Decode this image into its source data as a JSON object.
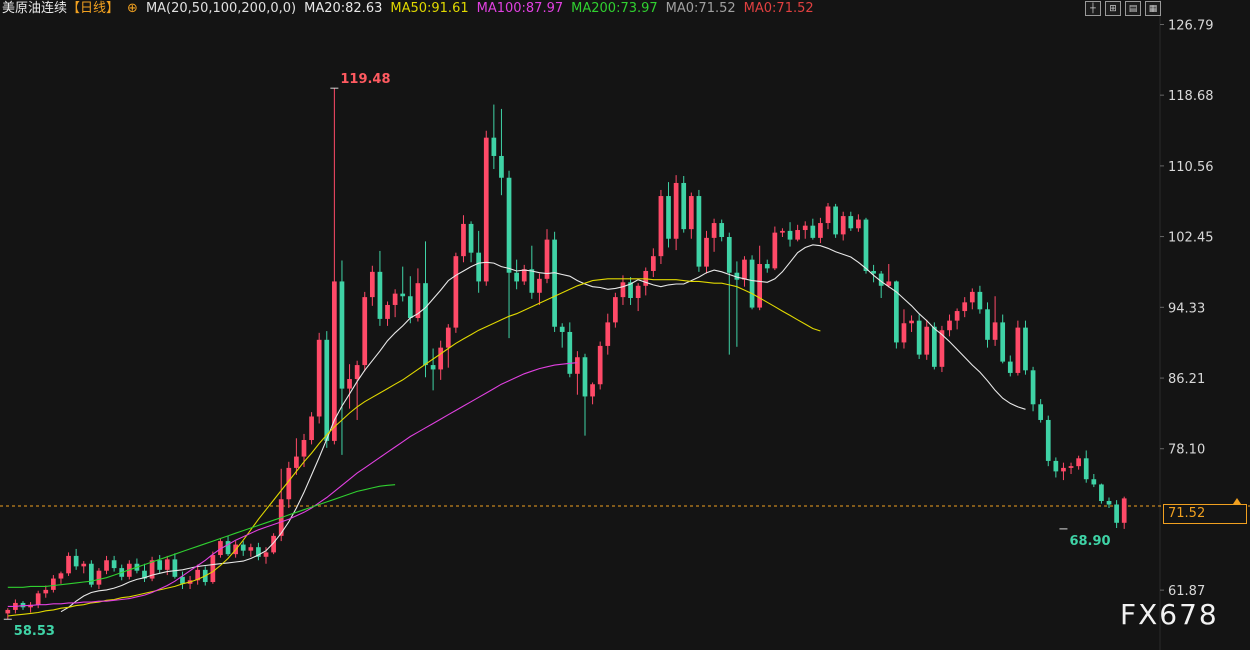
{
  "header": {
    "symbol": "美原油连续",
    "period": "【日线】",
    "ma_params": "MA(20,50,100,200,0,0)",
    "ma_values": [
      {
        "label": "MA20:82.63",
        "color": "#e8e8e8"
      },
      {
        "label": "MA50:91.61",
        "color": "#e0d800"
      },
      {
        "label": "MA100:87.97",
        "color": "#e040e0"
      },
      {
        "label": "MA200:73.97",
        "color": "#30d030"
      },
      {
        "label": "MA0:71.52",
        "color": "#a0a0a0"
      },
      {
        "label": "MA0:71.52",
        "color": "#e04040"
      }
    ]
  },
  "toolbar": {
    "icons": [
      "crosshair-icon",
      "zoom-icon",
      "indicator-icon",
      "settings-icon"
    ]
  },
  "watermark": "FX678",
  "current_price_tag": "71.52",
  "chart_data": {
    "type": "candlestick",
    "y_ticks": [
      "126.79",
      "118.68",
      "110.56",
      "102.45",
      "94.33",
      "86.21",
      "78.10",
      "61.87"
    ],
    "ylim": [
      55.0,
      129.6
    ],
    "annotations": {
      "high": {
        "label": "119.48",
        "value": 119.48,
        "index": 43
      },
      "low_left": {
        "label": "58.53",
        "value": 58.53,
        "index": 0
      },
      "low_right": {
        "label": "68.90",
        "value": 68.9,
        "index": 139
      }
    },
    "last_price": 71.52,
    "colors": {
      "up": "#ff4a68",
      "down": "#3fd3a6"
    },
    "candles": [
      [
        59.2,
        59.8,
        58.5,
        59.6
      ],
      [
        59.6,
        60.8,
        59.2,
        60.4
      ],
      [
        60.4,
        60.6,
        59.6,
        59.9
      ],
      [
        59.9,
        60.5,
        59.3,
        60.2
      ],
      [
        60.2,
        61.8,
        59.8,
        61.5
      ],
      [
        61.5,
        62.4,
        61.0,
        61.9
      ],
      [
        61.9,
        63.6,
        61.6,
        63.2
      ],
      [
        63.2,
        64.0,
        62.6,
        63.8
      ],
      [
        63.8,
        66.2,
        63.5,
        65.8
      ],
      [
        65.8,
        66.6,
        64.2,
        64.6
      ],
      [
        64.6,
        65.2,
        63.8,
        64.9
      ],
      [
        64.9,
        65.3,
        62.2,
        62.5
      ],
      [
        62.5,
        64.4,
        62.0,
        64.1
      ],
      [
        64.1,
        65.8,
        63.7,
        65.3
      ],
      [
        65.3,
        65.8,
        64.0,
        64.4
      ],
      [
        64.4,
        64.8,
        63.0,
        63.4
      ],
      [
        63.4,
        65.3,
        63.1,
        64.9
      ],
      [
        64.9,
        65.5,
        63.8,
        64.1
      ],
      [
        64.1,
        64.9,
        62.8,
        63.2
      ],
      [
        63.2,
        65.7,
        62.9,
        65.3
      ],
      [
        65.3,
        65.9,
        63.8,
        64.2
      ],
      [
        64.2,
        65.8,
        63.6,
        65.4
      ],
      [
        65.4,
        66.1,
        63.2,
        63.4
      ],
      [
        63.4,
        64.0,
        62.0,
        62.6
      ],
      [
        62.6,
        63.5,
        62.0,
        63.0
      ],
      [
        63.0,
        64.8,
        62.5,
        64.2
      ],
      [
        64.2,
        64.6,
        62.4,
        62.8
      ],
      [
        62.8,
        66.3,
        62.6,
        65.9
      ],
      [
        65.9,
        67.8,
        65.6,
        67.5
      ],
      [
        67.5,
        68.1,
        65.8,
        66.0
      ],
      [
        66.0,
        67.5,
        65.6,
        67.1
      ],
      [
        67.1,
        67.5,
        65.8,
        66.4
      ],
      [
        66.4,
        67.2,
        65.7,
        66.8
      ],
      [
        66.8,
        67.3,
        65.3,
        65.7
      ],
      [
        65.7,
        66.8,
        64.9,
        66.2
      ],
      [
        66.2,
        68.4,
        66.0,
        68.1
      ],
      [
        68.1,
        75.8,
        67.5,
        72.3
      ],
      [
        72.3,
        76.6,
        71.3,
        75.9
      ],
      [
        75.9,
        79.3,
        75.1,
        77.2
      ],
      [
        77.2,
        79.8,
        76.0,
        79.1
      ],
      [
        79.1,
        82.3,
        78.6,
        81.8
      ],
      [
        81.8,
        91.4,
        81.0,
        90.6
      ],
      [
        90.6,
        91.6,
        78.2,
        79.0
      ],
      [
        79.0,
        119.48,
        78.6,
        97.3
      ],
      [
        97.3,
        99.7,
        77.4,
        85.0
      ],
      [
        85.0,
        87.8,
        82.7,
        86.1
      ],
      [
        86.1,
        88.2,
        81.4,
        87.7
      ],
      [
        87.7,
        96.1,
        87.0,
        95.5
      ],
      [
        95.5,
        99.1,
        94.5,
        98.4
      ],
      [
        98.4,
        100.8,
        92.2,
        93.0
      ],
      [
        93.0,
        95.0,
        92.2,
        94.6
      ],
      [
        94.6,
        96.4,
        93.2,
        95.9
      ],
      [
        95.9,
        99.0,
        95.0,
        95.6
      ],
      [
        95.6,
        97.9,
        92.5,
        93.1
      ],
      [
        93.1,
        98.8,
        92.7,
        97.1
      ],
      [
        97.1,
        101.9,
        86.3,
        87.7
      ],
      [
        87.7,
        89.6,
        84.8,
        87.2
      ],
      [
        87.2,
        90.5,
        86.0,
        89.7
      ],
      [
        89.7,
        92.4,
        87.4,
        92.0
      ],
      [
        92.0,
        100.6,
        91.4,
        100.2
      ],
      [
        100.2,
        104.9,
        99.5,
        103.9
      ],
      [
        103.9,
        104.2,
        99.5,
        100.6
      ],
      [
        100.6,
        103.1,
        96.0,
        97.3
      ],
      [
        97.3,
        114.6,
        96.8,
        113.8
      ],
      [
        113.8,
        117.6,
        110.2,
        111.7
      ],
      [
        111.7,
        117.1,
        107.2,
        109.2
      ],
      [
        109.2,
        110.0,
        90.8,
        98.3
      ],
      [
        98.3,
        99.8,
        96.4,
        97.3
      ],
      [
        97.3,
        99.2,
        96.9,
        98.7
      ],
      [
        98.7,
        101.4,
        95.3,
        96.0
      ],
      [
        96.0,
        98.2,
        94.6,
        97.6
      ],
      [
        97.6,
        103.3,
        97.1,
        102.1
      ],
      [
        102.1,
        103.0,
        91.5,
        92.1
      ],
      [
        92.1,
        92.5,
        89.7,
        91.5
      ],
      [
        91.5,
        92.6,
        86.3,
        86.7
      ],
      [
        86.7,
        89.3,
        84.3,
        88.6
      ],
      [
        88.6,
        89.0,
        79.6,
        84.1
      ],
      [
        84.1,
        85.7,
        83.2,
        85.5
      ],
      [
        85.5,
        90.4,
        84.9,
        89.9
      ],
      [
        89.9,
        93.6,
        88.9,
        92.6
      ],
      [
        92.6,
        96.0,
        92.0,
        95.5
      ],
      [
        95.5,
        98.0,
        94.6,
        97.2
      ],
      [
        97.2,
        97.8,
        94.6,
        95.4
      ],
      [
        95.4,
        97.1,
        93.9,
        96.8
      ],
      [
        96.8,
        98.9,
        95.7,
        98.5
      ],
      [
        98.5,
        101.1,
        97.8,
        100.2
      ],
      [
        100.2,
        107.8,
        99.3,
        107.1
      ],
      [
        107.1,
        108.7,
        101.2,
        102.2
      ],
      [
        102.2,
        109.5,
        100.9,
        108.6
      ],
      [
        108.6,
        109.4,
        102.9,
        103.3
      ],
      [
        103.3,
        107.5,
        102.2,
        107.1
      ],
      [
        107.1,
        107.8,
        98.4,
        99.0
      ],
      [
        99.0,
        103.1,
        98.2,
        102.3
      ],
      [
        102.3,
        104.5,
        100.7,
        104.0
      ],
      [
        104.0,
        104.4,
        101.9,
        102.4
      ],
      [
        102.4,
        102.9,
        88.9,
        98.3
      ],
      [
        98.3,
        99.6,
        89.8,
        97.5
      ],
      [
        97.5,
        100.2,
        96.7,
        99.8
      ],
      [
        99.8,
        100.3,
        94.1,
        94.3
      ],
      [
        94.3,
        101.4,
        94.0,
        99.3
      ],
      [
        99.3,
        99.8,
        98.3,
        98.8
      ],
      [
        98.8,
        103.6,
        98.6,
        102.9
      ],
      [
        102.9,
        103.4,
        102.4,
        103.1
      ],
      [
        103.1,
        104.1,
        101.3,
        102.1
      ],
      [
        102.1,
        103.8,
        101.9,
        103.2
      ],
      [
        103.2,
        104.2,
        102.2,
        103.7
      ],
      [
        103.7,
        104.5,
        102.1,
        102.3
      ],
      [
        102.3,
        104.6,
        101.7,
        104.0
      ],
      [
        104.0,
        106.3,
        103.3,
        105.9
      ],
      [
        105.9,
        106.2,
        102.3,
        102.7
      ],
      [
        102.7,
        105.3,
        102.0,
        104.8
      ],
      [
        104.8,
        105.3,
        103.1,
        103.4
      ],
      [
        103.4,
        105.0,
        103.0,
        104.4
      ],
      [
        104.4,
        104.6,
        98.2,
        98.5
      ],
      [
        98.5,
        99.2,
        97.2,
        98.2
      ],
      [
        98.2,
        98.5,
        95.4,
        96.8
      ],
      [
        96.8,
        99.3,
        96.6,
        97.3
      ],
      [
        97.3,
        97.4,
        89.6,
        90.3
      ],
      [
        90.3,
        94.1,
        89.6,
        92.5
      ],
      [
        92.5,
        93.4,
        91.5,
        92.8
      ],
      [
        92.8,
        93.5,
        88.4,
        88.9
      ],
      [
        88.9,
        92.9,
        88.3,
        92.1
      ],
      [
        92.1,
        92.6,
        87.2,
        87.5
      ],
      [
        87.5,
        92.2,
        86.9,
        91.7
      ],
      [
        91.7,
        93.5,
        91.0,
        92.8
      ],
      [
        92.8,
        94.2,
        91.8,
        93.9
      ],
      [
        93.9,
        95.5,
        93.2,
        94.9
      ],
      [
        94.9,
        96.5,
        94.1,
        96.1
      ],
      [
        96.1,
        96.8,
        93.6,
        94.1
      ],
      [
        94.1,
        94.9,
        89.7,
        90.6
      ],
      [
        90.6,
        95.6,
        89.9,
        92.6
      ],
      [
        92.6,
        93.5,
        87.9,
        88.1
      ],
      [
        88.1,
        88.8,
        86.4,
        86.8
      ],
      [
        86.8,
        92.8,
        86.5,
        92.0
      ],
      [
        92.0,
        92.8,
        86.6,
        87.1
      ],
      [
        87.1,
        87.5,
        82.4,
        83.2
      ],
      [
        83.2,
        83.8,
        81.1,
        81.4
      ],
      [
        81.4,
        81.9,
        76.1,
        76.7
      ],
      [
        76.7,
        77.1,
        74.8,
        75.5
      ],
      [
        75.5,
        76.5,
        74.5,
        75.9
      ],
      [
        75.9,
        76.5,
        75.2,
        76.1
      ],
      [
        76.1,
        77.3,
        75.7,
        77.0
      ],
      [
        77.0,
        77.9,
        74.2,
        74.6
      ],
      [
        74.6,
        75.2,
        73.7,
        74.0
      ],
      [
        74.0,
        74.1,
        71.8,
        72.1
      ],
      [
        72.1,
        72.5,
        71.3,
        71.7
      ],
      [
        71.7,
        72.2,
        69.0,
        69.6
      ],
      [
        69.6,
        72.6,
        68.9,
        72.4
      ]
    ],
    "ma_series": [
      {
        "name": "MA20",
        "color": "#e8e8e8",
        "start": 7,
        "values": [
          59.4,
          59.9,
          60.6,
          61.2,
          61.6,
          61.8,
          61.9,
          62.1,
          62.4,
          62.8,
          63.1,
          63.3,
          63.6,
          63.8,
          64.0,
          64.1,
          64.2,
          64.4,
          64.6,
          64.7,
          64.8,
          64.9,
          65.0,
          65.1,
          65.2,
          65.5,
          65.9,
          66.4,
          67.3,
          68.4,
          69.7,
          71.3,
          73.1,
          75.1,
          77.1,
          79.2,
          81.4,
          83.0,
          84.4,
          85.8,
          87.1,
          88.2,
          89.3,
          90.5,
          91.4,
          92.2,
          93.1,
          93.6,
          94.3,
          95.3,
          96.3,
          97.4,
          98.0,
          98.5,
          99.0,
          99.4,
          99.5,
          99.4,
          99.0,
          98.8,
          98.5,
          98.6,
          98.5,
          98.3,
          98.2,
          98.3,
          98.1,
          97.9,
          97.4,
          97.0,
          96.7,
          96.6,
          96.4,
          96.5,
          96.7,
          97.0,
          97.5,
          97.2,
          96.9,
          96.7,
          96.9,
          97.0,
          97.0,
          97.4,
          97.8,
          98.3,
          98.6,
          98.4,
          98.1,
          97.8,
          97.6,
          97.4,
          97.3,
          97.2,
          97.6,
          98.4,
          99.5,
          100.6,
          101.2,
          101.5,
          101.4,
          101.1,
          100.7,
          100.4,
          100.1,
          99.5,
          98.8,
          98.0,
          97.3,
          96.7,
          96.1,
          95.3,
          94.5,
          93.6,
          92.8,
          91.9,
          91.2,
          90.4,
          89.5,
          88.6,
          87.7,
          86.9,
          85.9,
          84.8,
          83.9,
          83.3,
          82.9,
          82.63
        ]
      },
      {
        "name": "MA50",
        "color": "#e0d800",
        "start": 0,
        "values": [
          58.9,
          59.0,
          59.1,
          59.2,
          59.3,
          59.5,
          59.6,
          59.8,
          59.9,
          60.1,
          60.2,
          60.4,
          60.5,
          60.7,
          60.8,
          61.0,
          61.1,
          61.3,
          61.5,
          61.7,
          61.9,
          62.1,
          62.3,
          62.6,
          62.8,
          63.1,
          63.5,
          64.0,
          64.7,
          65.5,
          66.5,
          67.6,
          68.8,
          70.0,
          71.1,
          72.2,
          73.3,
          74.4,
          75.5,
          76.6,
          77.6,
          78.7,
          79.7,
          80.6,
          81.4,
          82.2,
          82.9,
          83.5,
          84.0,
          84.5,
          85.0,
          85.5,
          86.0,
          86.6,
          87.2,
          87.8,
          88.4,
          89.0,
          89.6,
          90.2,
          90.7,
          91.2,
          91.7,
          92.1,
          92.5,
          92.9,
          93.3,
          93.6,
          94.0,
          94.4,
          94.8,
          95.2,
          95.6,
          96.0,
          96.4,
          96.8,
          97.1,
          97.4,
          97.5,
          97.6,
          97.6,
          97.6,
          97.6,
          97.6,
          97.6,
          97.5,
          97.5,
          97.5,
          97.5,
          97.4,
          97.3,
          97.3,
          97.2,
          97.1,
          97.1,
          96.9,
          96.7,
          96.3,
          95.9,
          95.4,
          94.9,
          94.4,
          93.9,
          93.4,
          92.9,
          92.4,
          91.9,
          91.61
        ]
      },
      {
        "name": "MA100",
        "color": "#e040e0",
        "start": 0,
        "values": [
          60.0,
          60.0,
          60.1,
          60.1,
          60.2,
          60.2,
          60.3,
          60.3,
          60.4,
          60.4,
          60.5,
          60.5,
          60.6,
          60.6,
          60.7,
          60.8,
          60.9,
          61.1,
          61.3,
          61.6,
          62.0,
          62.4,
          62.9,
          63.5,
          64.1,
          64.7,
          65.3,
          66.0,
          66.6,
          67.1,
          67.6,
          68.0,
          68.4,
          68.8,
          69.1,
          69.4,
          69.7,
          70.0,
          70.4,
          70.8,
          71.3,
          71.9,
          72.5,
          73.2,
          73.9,
          74.6,
          75.3,
          75.9,
          76.5,
          77.1,
          77.7,
          78.3,
          78.9,
          79.5,
          80.0,
          80.5,
          81.0,
          81.5,
          82.0,
          82.5,
          83.0,
          83.5,
          84.0,
          84.5,
          85.0,
          85.5,
          85.9,
          86.3,
          86.7,
          87.0,
          87.3,
          87.5,
          87.7,
          87.8,
          87.9,
          87.97
        ]
      },
      {
        "name": "MA200",
        "color": "#30d030",
        "start": 0,
        "values": [
          62.2,
          62.2,
          62.2,
          62.3,
          62.3,
          62.3,
          62.4,
          62.5,
          62.6,
          62.7,
          62.8,
          62.9,
          63.1,
          63.3,
          63.6,
          63.9,
          64.2,
          64.5,
          64.8,
          65.1,
          65.4,
          65.7,
          66.0,
          66.3,
          66.6,
          66.9,
          67.2,
          67.5,
          67.8,
          68.1,
          68.4,
          68.7,
          69.0,
          69.3,
          69.6,
          69.9,
          70.2,
          70.5,
          70.8,
          71.1,
          71.4,
          71.7,
          72.0,
          72.3,
          72.6,
          72.9,
          73.2,
          73.4,
          73.6,
          73.8,
          73.9,
          73.97
        ]
      }
    ]
  }
}
